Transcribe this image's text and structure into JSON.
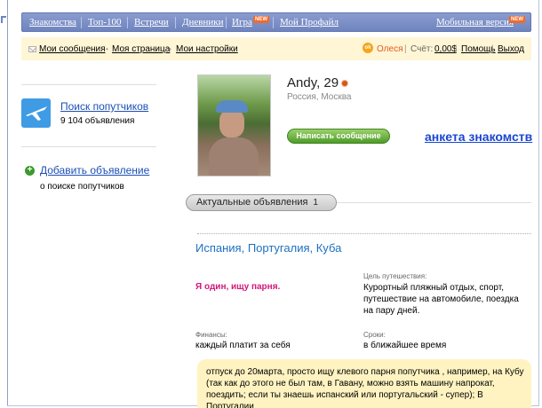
{
  "topnav": {
    "items": [
      "Знакомства",
      "Топ-100",
      "Встречи",
      "Дневники",
      "Игра",
      "Мой Профайл"
    ],
    "new_badge": "NEW",
    "mobile": "Мобильная версия"
  },
  "subnav": {
    "messages": "Мои сообщения",
    "my_page": "Моя страница",
    "settings": "Мои настройки",
    "user_name": "Олеся",
    "balance_label": "Счёт:",
    "balance_value": "0,00$",
    "help": "Помощь",
    "logout": "Выход"
  },
  "sidebar": {
    "search_link": "Поиск попутчиков",
    "search_count": "9 104 объявления",
    "add_link": "Добавить объявление",
    "add_sub": "о поиске попутчиков"
  },
  "profile": {
    "name_age": "Andy, 29",
    "location": "Россия, Москва",
    "write_button": "Написать сообщение",
    "dating_link": "анкета знакомств"
  },
  "ads": {
    "tab_label": "Актуальные объявления",
    "tab_count": "1",
    "title": "Испания, Португалия, Куба",
    "alone": "Я один, ищу парня.",
    "goal_label": "Цель путешествия:",
    "goal_value": "Курортный пляжный отдых, спорт, путешествие на автомобиле, поездка на пару дней.",
    "finance_label": "Финансы:",
    "finance_value": "каждый платит за себя",
    "terms_label": "Сроки:",
    "terms_value": "в ближайшее время",
    "description": "отпуск до 20марта, просто ищу клевого парня попутчика , например, на Кубу (так как до этого не был там, в Гавану, можно взять машину напрокат, поездить; если ты знаешь испанский или португальский - супер); В Португалии"
  }
}
